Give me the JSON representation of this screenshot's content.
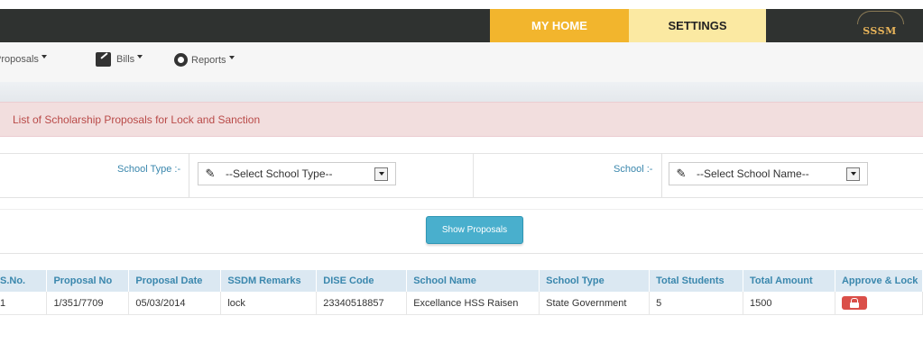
{
  "nav": {
    "home_label": "MY HOME",
    "settings_label": "SETTINGS",
    "logo_text": "SSSM"
  },
  "menu": {
    "proposals": "Proposals",
    "bills": "Bills",
    "reports": "Reports"
  },
  "alert": {
    "text": "List of Scholarship Proposals for Lock and Sanction"
  },
  "filters": {
    "school_type_label": "School Type :-",
    "school_type_value": "--Select School Type--",
    "school_label": "School :-",
    "school_value": "--Select School Name--"
  },
  "actions": {
    "show_proposals": "Show Proposals"
  },
  "table": {
    "headers": [
      "S.No.",
      "Proposal No",
      "Proposal Date",
      "SSDM Remarks",
      "DISE Code",
      "School Name",
      "School Type",
      "Total Students",
      "Total Amount",
      "Approve & Lock"
    ],
    "rows": [
      [
        "1",
        "1/351/7709",
        "05/03/2014",
        "lock",
        "23340518857",
        "Excellance HSS Raisen",
        "State Government",
        "5",
        "1500"
      ]
    ]
  },
  "colors": {
    "topbar": "#2f3230",
    "home_tab": "#f2b52d",
    "settings_tab": "#fbe9a2",
    "alert_bg": "#f2dede",
    "alert_text": "#b94a48",
    "label_blue": "#3a87ad",
    "button_info": "#49afcd",
    "lock_button": "#da4f49"
  },
  "icons": {
    "bills": "edit-icon",
    "reports": "disc-icon",
    "select_edit": "pencil-icon",
    "approve": "lock-icon"
  }
}
